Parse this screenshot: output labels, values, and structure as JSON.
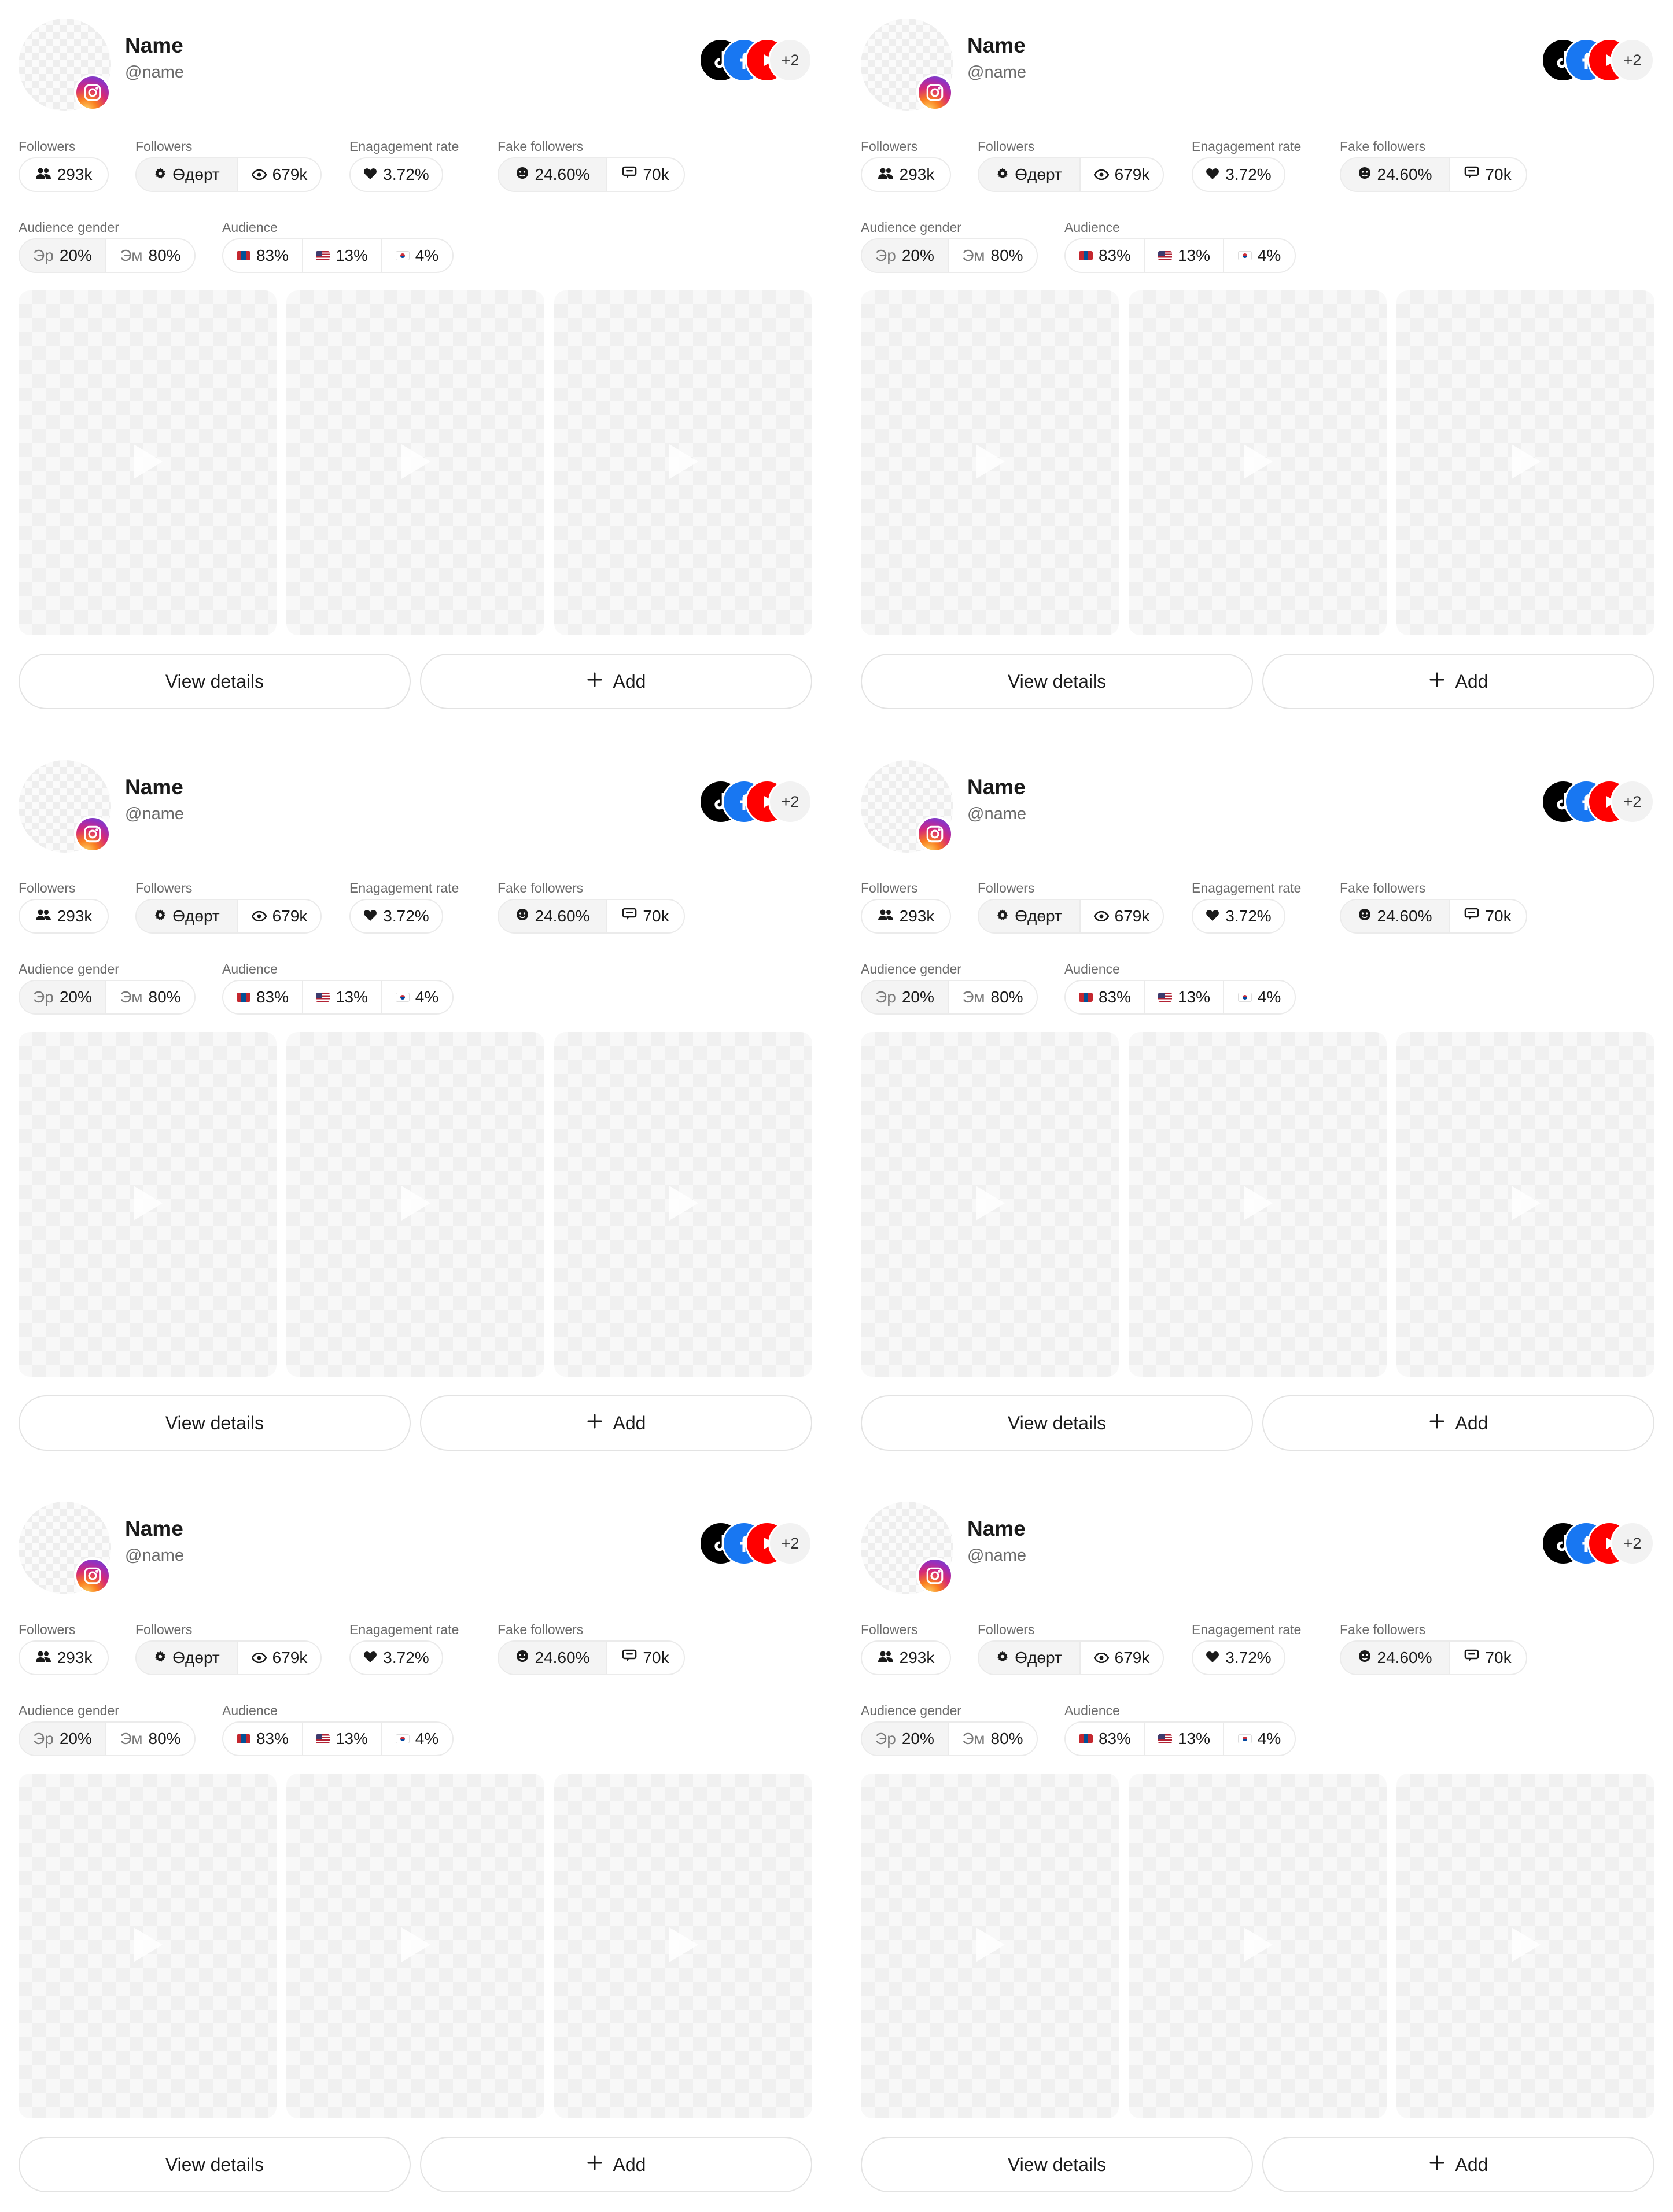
{
  "profile": {
    "name": "Name",
    "handle": "@name",
    "more_count": "+2"
  },
  "labels": {
    "followers": "Followers",
    "followers2": "Followers",
    "engagement": "Enagagement rate",
    "fake": "Fake followers",
    "gender": "Audience gender",
    "audience": "Audience"
  },
  "stats": {
    "followers": "293k",
    "daily_label": "Өдөрт",
    "views": "679k",
    "engagement": "3.72%",
    "fake_pct": "24.60%",
    "fake_count": "70k",
    "male_label": "Эр",
    "male_pct": "20%",
    "female_label": "Эм",
    "female_pct": "80%",
    "aud_mn": "83%",
    "aud_us": "13%",
    "aud_kr": "4%"
  },
  "actions": {
    "view": "View details",
    "add": "Add"
  },
  "colors": {
    "instagram": "#d62976",
    "tiktok": "#000000",
    "facebook": "#1877f2",
    "youtube": "#ff0000"
  },
  "icons": {
    "platform": "instagram-icon",
    "socials": [
      "tiktok-icon",
      "facebook-icon",
      "youtube-icon"
    ],
    "stats": [
      "users-icon",
      "gear-icon",
      "eye-icon",
      "heart-icon",
      "face-icon",
      "chat-icon"
    ],
    "flags": [
      "mongolia-flag-icon",
      "usa-flag-icon",
      "korea-flag-icon"
    ],
    "media": "play-icon",
    "add": "plus-icon"
  }
}
